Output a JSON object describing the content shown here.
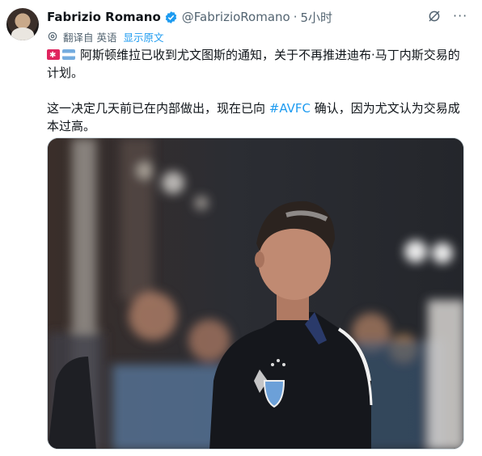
{
  "author": {
    "name": "Fabrizio Romano",
    "handle": "@FabrizioRomano",
    "separator": "·",
    "time": "5小时"
  },
  "translation": {
    "label": "翻译自 英语",
    "show_original": "显示原文"
  },
  "tweet": {
    "line1": "阿斯顿维拉已收到尤文图斯的通知，关于不再推进迪布·马丁内斯交易的计划。",
    "line2_before": "这一决定几天前已在内部做出，现在已向 ",
    "hashtag": "#AVFC",
    "line2_after": " 确认，因为尤文认为交易成本过高。"
  },
  "icons": [
    "avatar",
    "verified-badge-icon",
    "grok-icon",
    "more-icon",
    "translate-gear-icon",
    "siren-flag-icon",
    "argentina-flag-icon"
  ],
  "colors": {
    "accent": "#1d9bf0",
    "text": "#0f1419",
    "muted": "#536471",
    "border": "#cfd9de"
  }
}
